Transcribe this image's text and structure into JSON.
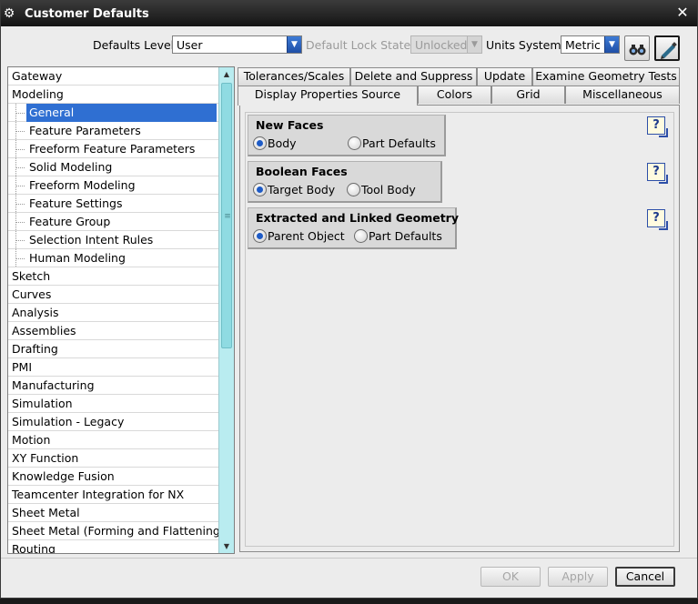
{
  "window": {
    "title": "Customer Defaults",
    "icon": "gear-icon"
  },
  "toolbar": {
    "defaults_level_label": "Defaults Level",
    "defaults_level_value": "User",
    "lock_state_label": "Default Lock State",
    "lock_state_value": "Unlocked",
    "units_label": "Units System",
    "units_value": "Metric"
  },
  "tree": {
    "items": [
      {
        "label": "Gateway",
        "level": 0
      },
      {
        "label": "Modeling",
        "level": 0
      },
      {
        "label": "General",
        "level": 1,
        "selected": true
      },
      {
        "label": "Feature Parameters",
        "level": 1
      },
      {
        "label": "Freeform Feature Parameters",
        "level": 1
      },
      {
        "label": "Solid Modeling",
        "level": 1
      },
      {
        "label": "Freeform Modeling",
        "level": 1
      },
      {
        "label": "Feature Settings",
        "level": 1
      },
      {
        "label": "Feature Group",
        "level": 1
      },
      {
        "label": "Selection Intent Rules",
        "level": 1
      },
      {
        "label": "Human Modeling",
        "level": 1
      },
      {
        "label": "Sketch",
        "level": 0
      },
      {
        "label": "Curves",
        "level": 0
      },
      {
        "label": "Analysis",
        "level": 0
      },
      {
        "label": "Assemblies",
        "level": 0
      },
      {
        "label": "Drafting",
        "level": 0
      },
      {
        "label": "PMI",
        "level": 0
      },
      {
        "label": "Manufacturing",
        "level": 0
      },
      {
        "label": "Simulation",
        "level": 0
      },
      {
        "label": "Simulation - Legacy",
        "level": 0
      },
      {
        "label": "Motion",
        "level": 0
      },
      {
        "label": "XY Function",
        "level": 0
      },
      {
        "label": "Knowledge Fusion",
        "level": 0
      },
      {
        "label": "Teamcenter Integration for NX",
        "level": 0
      },
      {
        "label": "Sheet Metal",
        "level": 0
      },
      {
        "label": "Sheet Metal (Forming and Flattening)",
        "level": 0
      },
      {
        "label": "Routing",
        "level": 0
      }
    ]
  },
  "tabs": {
    "row1": [
      "Tolerances/Scales",
      "Delete and Suppress",
      "Update",
      "Examine Geometry Tests"
    ],
    "row2": [
      "Display Properties Source",
      "Colors",
      "Grid",
      "Miscellaneous"
    ],
    "selected": "Display Properties Source"
  },
  "groups": {
    "new_faces": {
      "title": "New Faces",
      "opt1": "Body",
      "opt2": "Part Defaults",
      "selected": 1
    },
    "boolean_faces": {
      "title": "Boolean Faces",
      "opt1": "Target Body",
      "opt2": "Tool Body",
      "selected": 1
    },
    "extracted": {
      "title": "Extracted and Linked Geometry",
      "opt1": "Parent Object",
      "opt2": "Part Defaults",
      "selected": 1
    },
    "help_glyph": "?"
  },
  "buttons": {
    "ok": "OK",
    "apply": "Apply",
    "cancel": "Cancel"
  }
}
